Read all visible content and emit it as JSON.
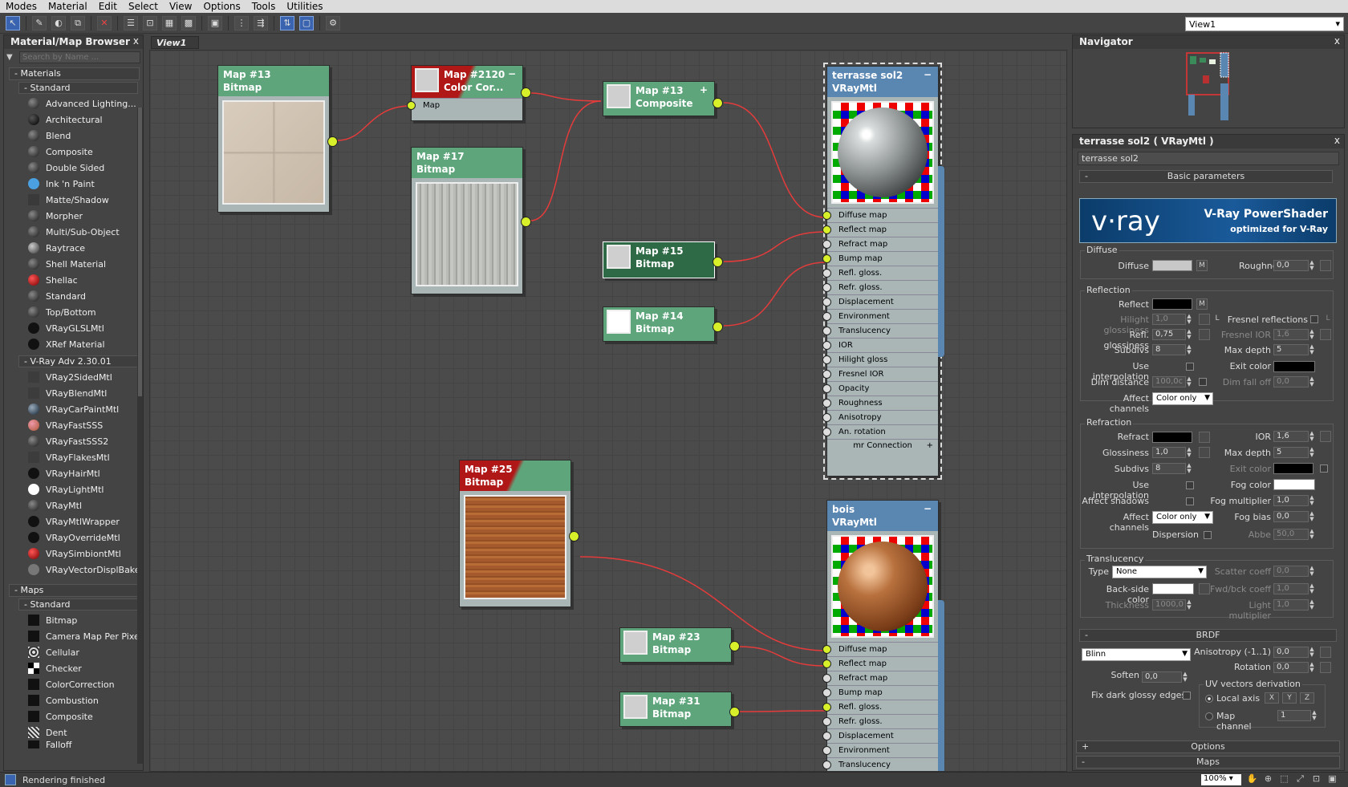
{
  "menu": [
    "Modes",
    "Material",
    "Edit",
    "Select",
    "View",
    "Options",
    "Tools",
    "Utilities"
  ],
  "toolbar": {
    "icons": [
      "select-arrow-icon",
      "eyedropper-icon",
      "pick-material-icon",
      "assign-material-icon",
      "delete-icon",
      "move-children-icon",
      "hide-unused-icon",
      "checker-background-icon",
      "render-map-icon",
      "view-icon",
      "layout-icon",
      "nodes-layout-icon",
      "show-map-icon",
      "show-background-icon",
      "options-icon"
    ]
  },
  "view_selector": "View1",
  "browser": {
    "title": "Material/Map Browser",
    "close": "x",
    "search_placeholder": "Search by Name ...",
    "materials_group": "- Materials",
    "standard_sub": "- Standard",
    "standard_items": [
      "Advanced Lighting...",
      "Architectural",
      "Blend",
      "Composite",
      "Double Sided",
      "Ink 'n Paint",
      "Matte/Shadow",
      "Morpher",
      "Multi/Sub-Object",
      "Raytrace",
      "Shell Material",
      "Shellac",
      "Standard",
      "Top/Bottom",
      "VRayGLSLMtl",
      "XRef Material"
    ],
    "vray_sub": "- V-Ray Adv 2.30.01",
    "vray_items": [
      "VRay2SidedMtl",
      "VRayBlendMtl",
      "VRayCarPaintMtl",
      "VRayFastSSS",
      "VRayFastSSS2",
      "VRayFlakesMtl",
      "VRayHairMtl",
      "VRayLightMtl",
      "VRayMtl",
      "VRayMtlWrapper",
      "VRayOverrideMtl",
      "VRaySimbiontMtl",
      "VRayVectorDisplBake"
    ],
    "maps_group": "- Maps",
    "maps_sub": "- Standard",
    "map_items": [
      "Bitmap",
      "Camera Map Per Pixel",
      "Cellular",
      "Checker",
      "ColorCorrection",
      "Combustion",
      "Composite",
      "Dent",
      "Falloff"
    ]
  },
  "view_tab": "View1",
  "nodes": {
    "map13": {
      "name": "Map #13",
      "type": "Bitmap"
    },
    "map2120": {
      "name": "Map #2120",
      "type": "Color Cor...",
      "port": "Map",
      "minus": "−"
    },
    "map13c": {
      "name": "Map #13",
      "type": "Composite",
      "plus": "+"
    },
    "map17": {
      "name": "Map #17",
      "type": "Bitmap"
    },
    "map15": {
      "name": "Map #15",
      "type": "Bitmap"
    },
    "map14": {
      "name": "Map #14",
      "type": "Bitmap"
    },
    "map25": {
      "name": "Map #25",
      "type": "Bitmap"
    },
    "map23": {
      "name": "Map #23",
      "type": "Bitmap"
    },
    "map31": {
      "name": "Map #31",
      "type": "Bitmap"
    },
    "mat1": {
      "name": "terrasse sol2",
      "type": "VRayMtl",
      "minus": "−",
      "connection": "mr Connection",
      "plus": "+",
      "ports": [
        "Diffuse map",
        "Reflect map",
        "Refract map",
        "Bump map",
        "Refl. gloss.",
        "Refr. gloss.",
        "Displacement",
        "Environment",
        "Translucency",
        "IOR",
        "Hilight gloss",
        "Fresnel IOR",
        "Opacity",
        "Roughness",
        "Anisotropy",
        "An. rotation"
      ]
    },
    "mat2": {
      "name": "bois",
      "type": "VRayMtl",
      "minus": "−",
      "ports": [
        "Diffuse map",
        "Reflect map",
        "Refract map",
        "Bump map",
        "Refl. gloss.",
        "Refr. gloss.",
        "Displacement",
        "Environment",
        "Translucency"
      ]
    }
  },
  "navigator": {
    "title": "Navigator",
    "close": "x"
  },
  "props": {
    "title": "terrasse sol2  ( VRayMtl )",
    "close": "x",
    "name_value": "terrasse sol2",
    "basic_params": "Basic parameters",
    "logo": {
      "brand": "v·ray",
      "title": "V-Ray PowerShader",
      "subtitle": "optimized for V-Ray"
    },
    "diffuse": {
      "group": "Diffuse",
      "label": "Diffuse",
      "m": "M",
      "roughness_label": "Roughness",
      "roughness": "0,0"
    },
    "reflection": {
      "group": "Reflection",
      "reflect": "Reflect",
      "m": "M",
      "hilight_label": "Hilight glossiness",
      "hilight": "1,0",
      "l": "L",
      "fresnel_label": "Fresnel reflections",
      "fresnel_l": "L",
      "refl_gloss_label": "Refl. glossiness",
      "refl_gloss": "0,75",
      "fresnel_ior_label": "Fresnel IOR",
      "fresnel_ior": "1,6",
      "subdivs_label": "Subdivs",
      "subdivs": "8",
      "max_depth_label": "Max depth",
      "max_depth": "5",
      "use_interp": "Use interpolation",
      "exit_color": "Exit color",
      "dim_dist_label": "Dim distance",
      "dim_dist": "100,0c",
      "dim_falloff_label": "Dim fall off",
      "dim_falloff": "0,0",
      "affect_label": "Affect channels",
      "affect": "Color only"
    },
    "refraction": {
      "group": "Refraction",
      "refract": "Refract",
      "ior_label": "IOR",
      "ior": "1,6",
      "gloss_label": "Glossiness",
      "gloss": "1,0",
      "max_depth_label": "Max depth",
      "max_depth": "5",
      "subdivs_label": "Subdivs",
      "subdivs": "8",
      "exit_color": "Exit color",
      "use_interp": "Use interpolation",
      "fog_color": "Fog color",
      "affect_shadows": "Affect shadows",
      "fog_mult_label": "Fog multiplier",
      "fog_mult": "1,0",
      "affect_label": "Affect channels",
      "affect": "Color only",
      "fog_bias_label": "Fog bias",
      "fog_bias": "0,0",
      "dispersion": "Dispersion",
      "abbe_label": "Abbe",
      "abbe": "50,0"
    },
    "translucency": {
      "group": "Translucency",
      "type_label": "Type",
      "type": "None",
      "scatter_label": "Scatter coeff",
      "scatter": "0,0",
      "backside": "Back-side color",
      "fwd_label": "Fwd/bck coeff",
      "fwd": "1,0",
      "thickness_label": "Thickness",
      "thickness": "1000,0",
      "light_mult_label": "Light multiplier",
      "light_mult": "1,0"
    },
    "brdf": {
      "title": "BRDF",
      "type": "Blinn",
      "aniso_label": "Anisotropy (-1..1)",
      "aniso": "0,0",
      "rotation_label": "Rotation",
      "rotation": "0,0",
      "soften_label": "Soften",
      "soften": "0,0",
      "uv_group": "UV vectors derivation",
      "fix_dark": "Fix dark glossy edges",
      "local_axis": "Local axis",
      "x": "X",
      "y": "Y",
      "z": "Z",
      "map_channel": "Map channel",
      "map_channel_val": "1"
    },
    "options": "Options",
    "maps": "Maps"
  },
  "status": {
    "text": "Rendering finished",
    "zoom": "100%"
  }
}
